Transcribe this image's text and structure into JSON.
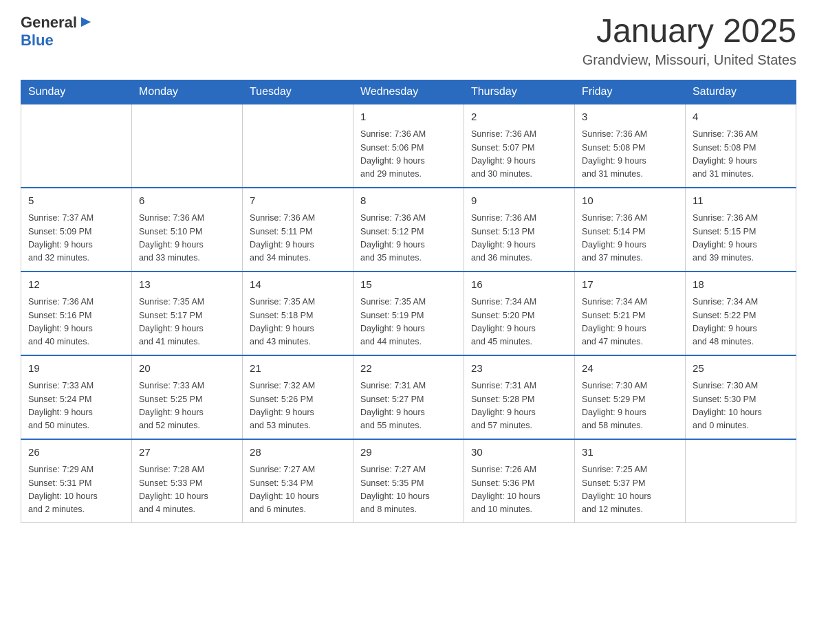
{
  "header": {
    "logo_general": "General",
    "logo_blue": "Blue",
    "month_title": "January 2025",
    "location": "Grandview, Missouri, United States"
  },
  "days_of_week": [
    "Sunday",
    "Monday",
    "Tuesday",
    "Wednesday",
    "Thursday",
    "Friday",
    "Saturday"
  ],
  "weeks": [
    [
      {
        "day": "",
        "info": ""
      },
      {
        "day": "",
        "info": ""
      },
      {
        "day": "",
        "info": ""
      },
      {
        "day": "1",
        "info": "Sunrise: 7:36 AM\nSunset: 5:06 PM\nDaylight: 9 hours\nand 29 minutes."
      },
      {
        "day": "2",
        "info": "Sunrise: 7:36 AM\nSunset: 5:07 PM\nDaylight: 9 hours\nand 30 minutes."
      },
      {
        "day": "3",
        "info": "Sunrise: 7:36 AM\nSunset: 5:08 PM\nDaylight: 9 hours\nand 31 minutes."
      },
      {
        "day": "4",
        "info": "Sunrise: 7:36 AM\nSunset: 5:08 PM\nDaylight: 9 hours\nand 31 minutes."
      }
    ],
    [
      {
        "day": "5",
        "info": "Sunrise: 7:37 AM\nSunset: 5:09 PM\nDaylight: 9 hours\nand 32 minutes."
      },
      {
        "day": "6",
        "info": "Sunrise: 7:36 AM\nSunset: 5:10 PM\nDaylight: 9 hours\nand 33 minutes."
      },
      {
        "day": "7",
        "info": "Sunrise: 7:36 AM\nSunset: 5:11 PM\nDaylight: 9 hours\nand 34 minutes."
      },
      {
        "day": "8",
        "info": "Sunrise: 7:36 AM\nSunset: 5:12 PM\nDaylight: 9 hours\nand 35 minutes."
      },
      {
        "day": "9",
        "info": "Sunrise: 7:36 AM\nSunset: 5:13 PM\nDaylight: 9 hours\nand 36 minutes."
      },
      {
        "day": "10",
        "info": "Sunrise: 7:36 AM\nSunset: 5:14 PM\nDaylight: 9 hours\nand 37 minutes."
      },
      {
        "day": "11",
        "info": "Sunrise: 7:36 AM\nSunset: 5:15 PM\nDaylight: 9 hours\nand 39 minutes."
      }
    ],
    [
      {
        "day": "12",
        "info": "Sunrise: 7:36 AM\nSunset: 5:16 PM\nDaylight: 9 hours\nand 40 minutes."
      },
      {
        "day": "13",
        "info": "Sunrise: 7:35 AM\nSunset: 5:17 PM\nDaylight: 9 hours\nand 41 minutes."
      },
      {
        "day": "14",
        "info": "Sunrise: 7:35 AM\nSunset: 5:18 PM\nDaylight: 9 hours\nand 43 minutes."
      },
      {
        "day": "15",
        "info": "Sunrise: 7:35 AM\nSunset: 5:19 PM\nDaylight: 9 hours\nand 44 minutes."
      },
      {
        "day": "16",
        "info": "Sunrise: 7:34 AM\nSunset: 5:20 PM\nDaylight: 9 hours\nand 45 minutes."
      },
      {
        "day": "17",
        "info": "Sunrise: 7:34 AM\nSunset: 5:21 PM\nDaylight: 9 hours\nand 47 minutes."
      },
      {
        "day": "18",
        "info": "Sunrise: 7:34 AM\nSunset: 5:22 PM\nDaylight: 9 hours\nand 48 minutes."
      }
    ],
    [
      {
        "day": "19",
        "info": "Sunrise: 7:33 AM\nSunset: 5:24 PM\nDaylight: 9 hours\nand 50 minutes."
      },
      {
        "day": "20",
        "info": "Sunrise: 7:33 AM\nSunset: 5:25 PM\nDaylight: 9 hours\nand 52 minutes."
      },
      {
        "day": "21",
        "info": "Sunrise: 7:32 AM\nSunset: 5:26 PM\nDaylight: 9 hours\nand 53 minutes."
      },
      {
        "day": "22",
        "info": "Sunrise: 7:31 AM\nSunset: 5:27 PM\nDaylight: 9 hours\nand 55 minutes."
      },
      {
        "day": "23",
        "info": "Sunrise: 7:31 AM\nSunset: 5:28 PM\nDaylight: 9 hours\nand 57 minutes."
      },
      {
        "day": "24",
        "info": "Sunrise: 7:30 AM\nSunset: 5:29 PM\nDaylight: 9 hours\nand 58 minutes."
      },
      {
        "day": "25",
        "info": "Sunrise: 7:30 AM\nSunset: 5:30 PM\nDaylight: 10 hours\nand 0 minutes."
      }
    ],
    [
      {
        "day": "26",
        "info": "Sunrise: 7:29 AM\nSunset: 5:31 PM\nDaylight: 10 hours\nand 2 minutes."
      },
      {
        "day": "27",
        "info": "Sunrise: 7:28 AM\nSunset: 5:33 PM\nDaylight: 10 hours\nand 4 minutes."
      },
      {
        "day": "28",
        "info": "Sunrise: 7:27 AM\nSunset: 5:34 PM\nDaylight: 10 hours\nand 6 minutes."
      },
      {
        "day": "29",
        "info": "Sunrise: 7:27 AM\nSunset: 5:35 PM\nDaylight: 10 hours\nand 8 minutes."
      },
      {
        "day": "30",
        "info": "Sunrise: 7:26 AM\nSunset: 5:36 PM\nDaylight: 10 hours\nand 10 minutes."
      },
      {
        "day": "31",
        "info": "Sunrise: 7:25 AM\nSunset: 5:37 PM\nDaylight: 10 hours\nand 12 minutes."
      },
      {
        "day": "",
        "info": ""
      }
    ]
  ]
}
